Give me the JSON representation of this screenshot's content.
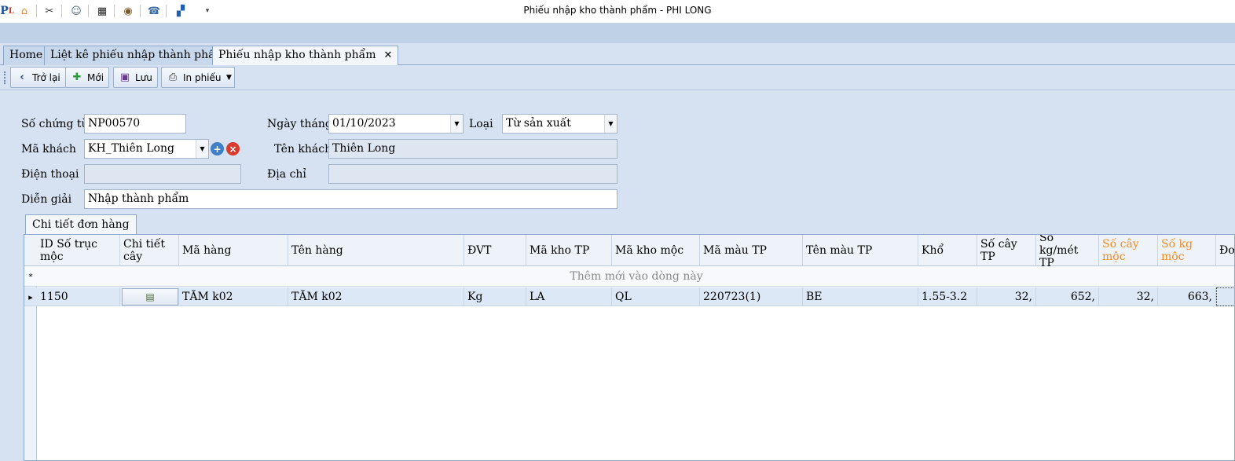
{
  "window": {
    "title": "Phiếu nhập kho thành phẩm - PHI LONG",
    "quick_access": [
      "app-logo-icon",
      "home-icon",
      "tools-icon",
      "users-icon",
      "clapper-icon",
      "eye-icon",
      "phone-icon",
      "windows-icon",
      "dropdown-icon"
    ]
  },
  "tabs": [
    {
      "label": "Home"
    },
    {
      "label": "Liệt kê phiếu nhập thành phẩm"
    },
    {
      "label": "Phiếu nhập kho thành phẩm",
      "close": "✕"
    }
  ],
  "toolbar": {
    "back_label": "Trở lại",
    "new_label": "Mới",
    "save_label": "Lưu",
    "print_label": "In phiếu"
  },
  "form": {
    "so_chung_tu_label": "Số chứng từ",
    "so_chung_tu_value": "NP00570",
    "ngay_thang_label": "Ngày tháng",
    "ngay_thang_value": "01/10/2023",
    "loai_label": "Loại",
    "loai_value": "Từ sản xuất",
    "ma_khach_label": "Mã khách",
    "ma_khach_value": "KH_Thiên Long",
    "ten_khach_label": "Tên khách",
    "ten_khach_value": "Thiên Long",
    "dien_thoai_label": "Điện thoại",
    "dien_thoai_value": "",
    "dia_chi_label": "Địa chỉ",
    "dia_chi_value": "",
    "dien_giai_label": "Diễn giải",
    "dien_giai_value": "Nhập thành phẩm"
  },
  "detail_tab": {
    "label": "Chi tiết đơn hàng"
  },
  "grid": {
    "columns": [
      {
        "label": "ID Số trục mộc",
        "highlight": false
      },
      {
        "label": "Chi tiết cây",
        "highlight": false
      },
      {
        "label": "Mã hàng",
        "highlight": false
      },
      {
        "label": "Tên hàng",
        "highlight": false
      },
      {
        "label": "ĐVT",
        "highlight": false
      },
      {
        "label": "Mã kho TP",
        "highlight": false
      },
      {
        "label": "Mã kho mộc",
        "highlight": false
      },
      {
        "label": "Mã màu TP",
        "highlight": false
      },
      {
        "label": "Tên màu TP",
        "highlight": false
      },
      {
        "label": "Khổ",
        "highlight": false
      },
      {
        "label": "Số cây TP",
        "highlight": false
      },
      {
        "label": "Số kg/mét TP",
        "highlight": false
      },
      {
        "label": "Số cây mộc",
        "highlight": true
      },
      {
        "label": "Số kg mộc",
        "highlight": true
      },
      {
        "label": "Đơ",
        "highlight": false
      }
    ],
    "new_row_text": "Thêm mới vào dòng này",
    "new_row_marker": "*",
    "current_row_marker": "▸",
    "rows": [
      {
        "id_so_truc_moc": "1150",
        "ma_hang": "TĂM k02",
        "ten_hang": "TĂM k02",
        "dvt": "Kg",
        "ma_kho_tp": "LA",
        "ma_kho_moc": "QL",
        "ma_mau_tp": "220723(1)",
        "ten_mau_tp": "BE",
        "kho": "1.55-3.2",
        "so_cay_tp": "32,",
        "so_kg_met_tp": "652,",
        "so_cay_moc": "32,",
        "so_kg_moc": "663,"
      }
    ]
  },
  "colors": {
    "highlight_header": "#f08c1e",
    "panel_bg": "#d6e2f1",
    "selected_row": "#dce8f6"
  }
}
